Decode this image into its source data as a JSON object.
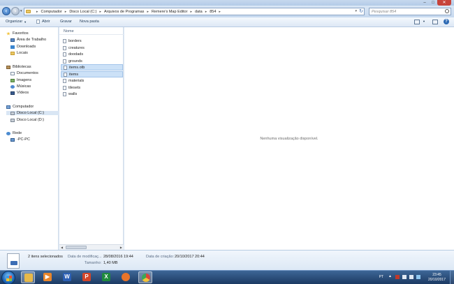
{
  "window": {
    "controls": {
      "minimize": "–",
      "maximize": "□",
      "close": "✕"
    }
  },
  "address": {
    "crumbs": [
      "Computador",
      "Disco Local (C:)",
      "Arquivos de Programas",
      "Remere's Map Editor",
      "data",
      "854"
    ],
    "search_placeholder": "Pesquisar 854"
  },
  "toolbar": {
    "organize": "Organizar",
    "open": "Abrir",
    "burn": "Gravar",
    "new_folder": "Nova pasta",
    "help": "?"
  },
  "nav": {
    "favorites": {
      "header": "Favoritos",
      "items": [
        "Área de Trabalho",
        "Downloads",
        "Locais"
      ]
    },
    "libraries": {
      "header": "Bibliotecas",
      "items": [
        "Documentos",
        "Imagens",
        "Músicas",
        "Vídeos"
      ]
    },
    "computer": {
      "header": "Computador",
      "items": [
        "Disco Local (C:)",
        "Disco Local (D:)"
      ]
    },
    "network": {
      "header": "Rede",
      "items": [
        "-PC-PC"
      ]
    }
  },
  "files": {
    "column_name": "Nome",
    "items": [
      "borders",
      "creatures",
      "doodads",
      "grounds",
      "items.otb",
      "items",
      "materials",
      "tilesets",
      "walls"
    ],
    "selected": [
      "items.otb",
      "items"
    ]
  },
  "preview": {
    "message": "Nenhuma visualização disponível."
  },
  "details": {
    "count": "2 itens selecionados",
    "modified_label": "Data de modificaç...",
    "modified_value": "28/08/2016 19:44",
    "created_label": "Data de criação:",
    "created_value": "20/10/2017 20:44",
    "size_label": "Tamanho:",
    "size_value": "1,40 MB"
  },
  "taskbar": {
    "apps": [
      {
        "name": "explorer",
        "glyph": "",
        "color": "#e7b949"
      },
      {
        "name": "media-player",
        "glyph": "▶",
        "color": "#e9862b"
      },
      {
        "name": "word",
        "glyph": "W",
        "color": "#2b5fb4"
      },
      {
        "name": "powerpoint",
        "glyph": "P",
        "color": "#d2452a"
      },
      {
        "name": "excel",
        "glyph": "X",
        "color": "#1f8a3d"
      },
      {
        "name": "firefox",
        "glyph": "",
        "color": "#e8742a"
      },
      {
        "name": "chrome",
        "glyph": "",
        "color": "#d9473b"
      }
    ],
    "language": "PT",
    "time": "23:45",
    "date": "20/10/2017"
  }
}
